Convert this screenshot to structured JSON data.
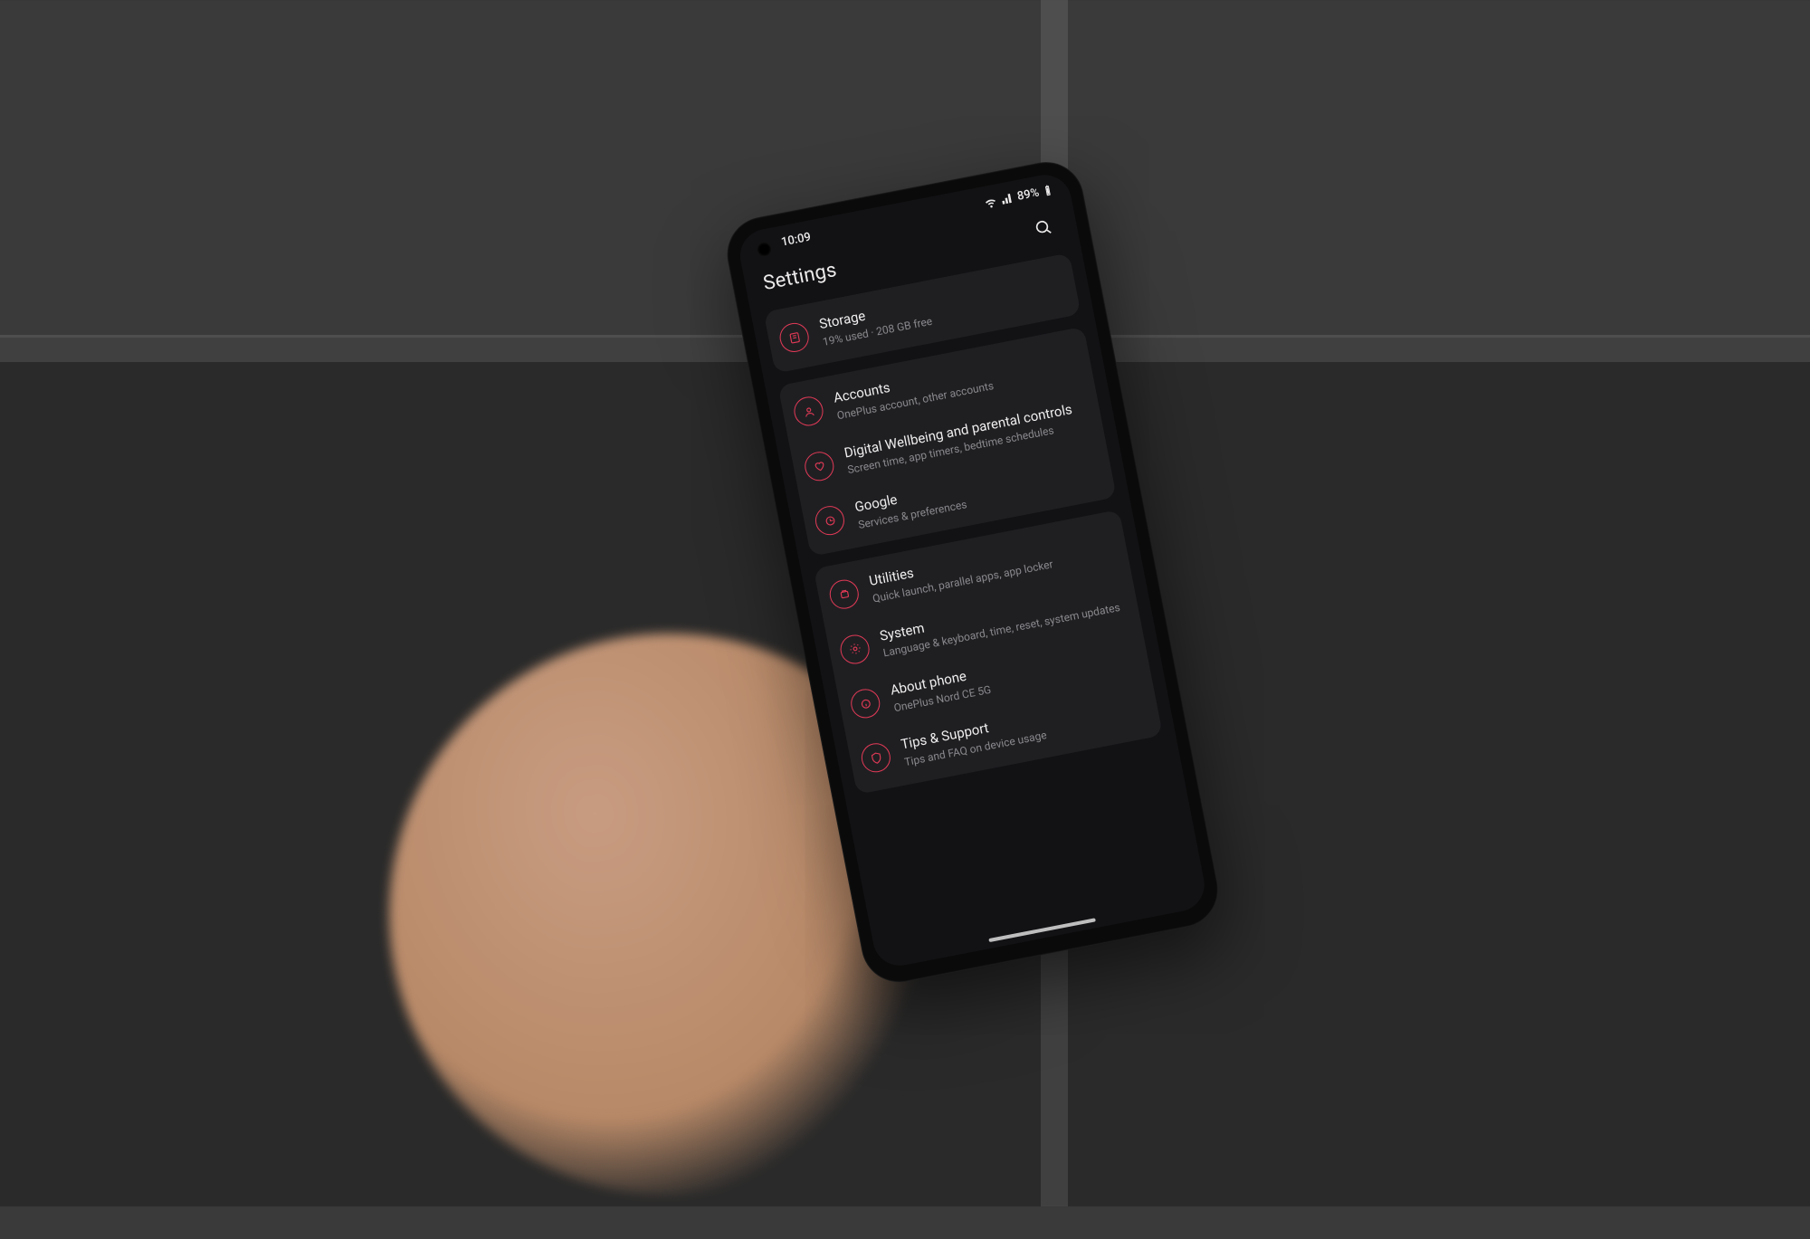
{
  "status": {
    "time": "10:09",
    "battery_text": "89%",
    "icons": {
      "wifi": "wifi-icon",
      "signal": "signal-icon",
      "battery": "battery-icon"
    }
  },
  "header": {
    "title": "Settings",
    "search_label": "Search"
  },
  "accent_color": "#e23a56",
  "groups": [
    {
      "items": [
        {
          "icon": "storage-icon",
          "title": "Storage",
          "subtitle": "19% used · 208 GB free"
        }
      ]
    },
    {
      "items": [
        {
          "icon": "accounts-icon",
          "title": "Accounts",
          "subtitle": "OnePlus account, other accounts"
        },
        {
          "icon": "wellbeing-icon",
          "title": "Digital Wellbeing and parental controls",
          "subtitle": "Screen time, app timers, bedtime schedules"
        },
        {
          "icon": "google-icon",
          "title": "Google",
          "subtitle": "Services & preferences"
        }
      ]
    },
    {
      "items": [
        {
          "icon": "utilities-icon",
          "title": "Utilities",
          "subtitle": "Quick launch, parallel apps, app locker"
        },
        {
          "icon": "system-icon",
          "title": "System",
          "subtitle": "Language & keyboard, time, reset, system updates"
        },
        {
          "icon": "about-icon",
          "title": "About phone",
          "subtitle": "OnePlus Nord CE 5G"
        },
        {
          "icon": "tips-icon",
          "title": "Tips & Support",
          "subtitle": "Tips and FAQ on device usage"
        }
      ]
    }
  ]
}
